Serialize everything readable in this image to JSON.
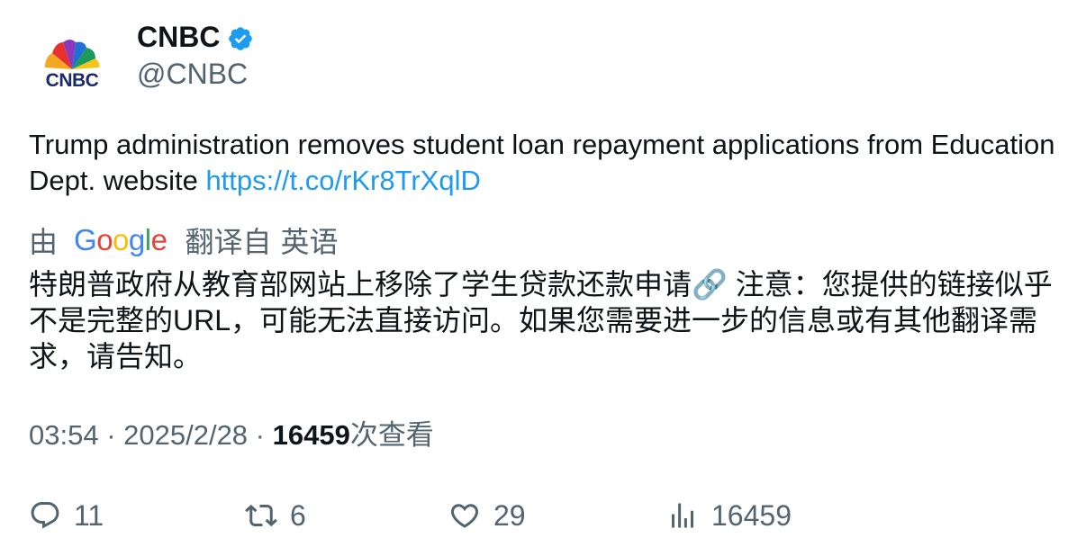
{
  "author": {
    "name": "CNBC",
    "handle": "@CNBC",
    "avatar_logo_text": "CNBC",
    "verified_icon": "verified-badge-icon",
    "verified_color": "#1d9bf0"
  },
  "tweet": {
    "text": "Trump administration removes student loan repayment applications from Education Dept. website ",
    "link": "https://t.co/rKr8TrXqlD"
  },
  "translation": {
    "prefix": "由",
    "provider": [
      "G",
      "o",
      "o",
      "g",
      "l",
      "e"
    ],
    "provider_colors": [
      "#4285F4",
      "#EA4335",
      "#FBBC05",
      "#4285F4",
      "#34A853",
      "#EA4335"
    ],
    "translated_from": "翻译自",
    "language": "英语",
    "text": "特朗普政府从教育部网站上移除了学生贷款还款申请🔗 注意：您提供的链接似乎不是完整的URL，可能无法直接访问。如果您需要进一步的信息或有其他翻译需求，请告知。"
  },
  "meta": {
    "time": "03:54",
    "separator": " · ",
    "date": "2025/2/28",
    "views_count": "16459",
    "views_label": "次查看"
  },
  "actions": {
    "replies": "11",
    "retweets": "6",
    "likes": "29",
    "views": "16459"
  },
  "colors": {
    "link": "#1d9bf0",
    "secondary_text": "#536471",
    "primary_text": "#0f1419"
  }
}
